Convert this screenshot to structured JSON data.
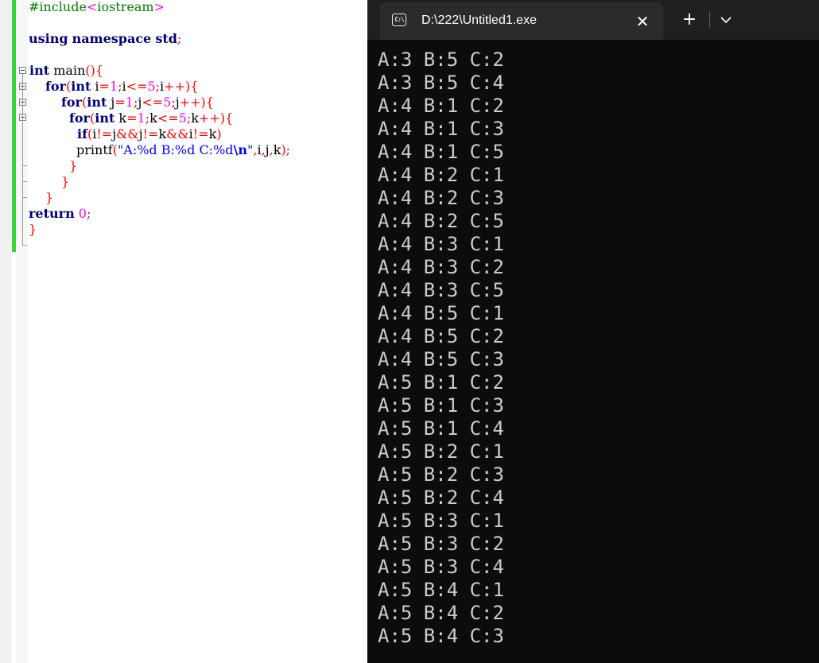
{
  "editor": {
    "code_lines": [
      {
        "tokens": [
          {
            "t": "#include",
            "c": "pp"
          },
          {
            "t": "<",
            "c": "ang"
          },
          {
            "t": "iostream",
            "c": "pp"
          },
          {
            "t": ">",
            "c": "ang"
          }
        ]
      },
      {
        "tokens": [
          {
            "t": "using",
            "c": "kw"
          },
          {
            "t": " ",
            "c": ""
          },
          {
            "t": "namespace",
            "c": "kw"
          },
          {
            "t": " ",
            "c": ""
          },
          {
            "t": "std",
            "c": "kw"
          },
          {
            "t": ";",
            "c": "sym"
          }
        ]
      },
      {
        "tokens": [
          {
            "t": "int",
            "c": "kw"
          },
          {
            "t": " main",
            "c": ""
          },
          {
            "t": "(){",
            "c": "sym"
          }
        ]
      },
      {
        "tokens": [
          {
            "t": "for",
            "c": "kw"
          },
          {
            "t": "(",
            "c": "sym"
          },
          {
            "t": "int",
            "c": "kw"
          },
          {
            "t": " i",
            "c": ""
          },
          {
            "t": "=",
            "c": "sym"
          },
          {
            "t": "1",
            "c": "num"
          },
          {
            "t": ";",
            "c": "sym"
          },
          {
            "t": "i",
            "c": ""
          },
          {
            "t": "<=",
            "c": "sym"
          },
          {
            "t": "5",
            "c": "num"
          },
          {
            "t": ";",
            "c": "sym"
          },
          {
            "t": "i",
            "c": ""
          },
          {
            "t": "++){",
            "c": "sym"
          }
        ]
      },
      {
        "tokens": [
          {
            "t": "for",
            "c": "kw"
          },
          {
            "t": "(",
            "c": "sym"
          },
          {
            "t": "int",
            "c": "kw"
          },
          {
            "t": " j",
            "c": ""
          },
          {
            "t": "=",
            "c": "sym"
          },
          {
            "t": "1",
            "c": "num"
          },
          {
            "t": ";",
            "c": "sym"
          },
          {
            "t": "j",
            "c": ""
          },
          {
            "t": "<=",
            "c": "sym"
          },
          {
            "t": "5",
            "c": "num"
          },
          {
            "t": ";",
            "c": "sym"
          },
          {
            "t": "j",
            "c": ""
          },
          {
            "t": "++){",
            "c": "sym"
          }
        ]
      },
      {
        "tokens": [
          {
            "t": "for",
            "c": "kw"
          },
          {
            "t": "(",
            "c": "sym"
          },
          {
            "t": "int",
            "c": "kw"
          },
          {
            "t": " k",
            "c": ""
          },
          {
            "t": "=",
            "c": "sym"
          },
          {
            "t": "1",
            "c": "num"
          },
          {
            "t": ";",
            "c": "sym"
          },
          {
            "t": "k",
            "c": ""
          },
          {
            "t": "<=",
            "c": "sym"
          },
          {
            "t": "5",
            "c": "num"
          },
          {
            "t": ";",
            "c": "sym"
          },
          {
            "t": "k",
            "c": ""
          },
          {
            "t": "++){",
            "c": "sym"
          }
        ]
      },
      {
        "tokens": [
          {
            "t": "if",
            "c": "kw"
          },
          {
            "t": "(",
            "c": "sym"
          },
          {
            "t": "i",
            "c": ""
          },
          {
            "t": "!=",
            "c": "sym"
          },
          {
            "t": "j",
            "c": ""
          },
          {
            "t": "&&",
            "c": "sym"
          },
          {
            "t": "j",
            "c": ""
          },
          {
            "t": "!=",
            "c": "sym"
          },
          {
            "t": "k",
            "c": ""
          },
          {
            "t": "&&",
            "c": "sym"
          },
          {
            "t": "i",
            "c": ""
          },
          {
            "t": "!=",
            "c": "sym"
          },
          {
            "t": "k",
            "c": ""
          },
          {
            "t": ")",
            "c": "sym"
          }
        ]
      },
      {
        "tokens": [
          {
            "t": "printf",
            "c": ""
          },
          {
            "t": "(",
            "c": "sym"
          },
          {
            "t": "\"A:%d B:%d C:%d",
            "c": "str"
          },
          {
            "t": "\\n",
            "c": "ctl"
          },
          {
            "t": "\"",
            "c": "str"
          },
          {
            "t": ",",
            "c": "sym"
          },
          {
            "t": "i",
            "c": ""
          },
          {
            "t": ",",
            "c": "sym"
          },
          {
            "t": "j",
            "c": ""
          },
          {
            "t": ",",
            "c": "sym"
          },
          {
            "t": "k",
            "c": ""
          },
          {
            "t": ");",
            "c": "sym"
          }
        ]
      },
      {
        "tokens": [
          {
            "t": "}",
            "c": "sym"
          }
        ]
      },
      {
        "tokens": [
          {
            "t": "}",
            "c": "sym"
          }
        ]
      },
      {
        "tokens": [
          {
            "t": "}",
            "c": "sym"
          }
        ]
      },
      {
        "tokens": [
          {
            "t": "return",
            "c": "kw"
          },
          {
            "t": " ",
            "c": ""
          },
          {
            "t": "0",
            "c": "num"
          },
          {
            "t": ";",
            "c": "sym"
          }
        ]
      },
      {
        "tokens": [
          {
            "t": "}",
            "c": "sym"
          }
        ]
      }
    ]
  },
  "terminal": {
    "tab_title": "D:\\222\\Untitled1.exe",
    "tab_icon": "cmd-icon",
    "icon_text": "C:\\",
    "close_glyph": "✕",
    "new_tab_glyph": "+",
    "dropdown_icon": "chevron-down-icon",
    "output_lines": [
      "A:3 B:5 C:2",
      "A:3 B:5 C:4",
      "A:4 B:1 C:2",
      "A:4 B:1 C:3",
      "A:4 B:1 C:5",
      "A:4 B:2 C:1",
      "A:4 B:2 C:3",
      "A:4 B:2 C:5",
      "A:4 B:3 C:1",
      "A:4 B:3 C:2",
      "A:4 B:3 C:5",
      "A:4 B:5 C:1",
      "A:4 B:5 C:2",
      "A:4 B:5 C:3",
      "A:5 B:1 C:2",
      "A:5 B:1 C:3",
      "A:5 B:1 C:4",
      "A:5 B:2 C:1",
      "A:5 B:2 C:3",
      "A:5 B:2 C:4",
      "A:5 B:3 C:1",
      "A:5 B:3 C:2",
      "A:5 B:3 C:4",
      "A:5 B:4 C:1",
      "A:5 B:4 C:2",
      "A:5 B:4 C:3"
    ]
  },
  "colors": {
    "terminal_bg": "#0c0c0c",
    "terminal_text": "#cccccc",
    "titlebar_bg": "#202020",
    "active_tab_bg": "#2b2b2b",
    "change_bar": "#3bd43b"
  }
}
